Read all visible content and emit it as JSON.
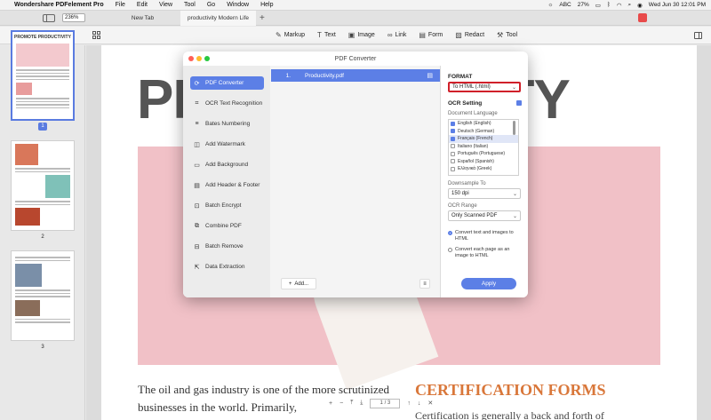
{
  "menubar": {
    "app_name": "Wondershare PDFelement Pro",
    "items": [
      "File",
      "Edit",
      "View",
      "Tool",
      "Go",
      "Window",
      "Help"
    ],
    "input_method": "ABC",
    "battery": "27%",
    "datetime": "Wed Jun 30  12:01 PM"
  },
  "tabs": {
    "zoom": "236%",
    "items": [
      {
        "label": "New Tab"
      },
      {
        "label": "productivity Modern Life"
      }
    ]
  },
  "toolbar": {
    "tools": [
      {
        "label": "Markup",
        "icon": "pen-icon",
        "glyph": "✎"
      },
      {
        "label": "Text",
        "icon": "text-icon",
        "glyph": "T"
      },
      {
        "label": "Image",
        "icon": "image-icon",
        "glyph": "▣"
      },
      {
        "label": "Link",
        "icon": "link-icon",
        "glyph": "∞"
      },
      {
        "label": "Form",
        "icon": "form-icon",
        "glyph": "▤"
      },
      {
        "label": "Redact",
        "icon": "redact-icon",
        "glyph": "▨"
      },
      {
        "label": "Tool",
        "icon": "toolbox-icon",
        "glyph": "⚒"
      }
    ]
  },
  "thumbnails": {
    "first_title": "PROMOTE PRODUCTIVITY",
    "pages": [
      "1",
      "2",
      "3"
    ]
  },
  "document": {
    "title_left": "PR",
    "title_right": "TIVITY",
    "body_text": "The oil and gas industry is one of the more scrutinized businesses in the world. Primarily,",
    "section_title": "CERTIFICATION FORMS",
    "section_text": "Certification is generally a back and forth of"
  },
  "pagenav": {
    "current": "1",
    "separator": "/",
    "total": "3"
  },
  "dialog": {
    "title": "PDF Converter",
    "nav": [
      {
        "label": "PDF Converter",
        "glyph": "⟳"
      },
      {
        "label": "OCR Text Recognition",
        "glyph": "⌗"
      },
      {
        "label": "Bates Numbering",
        "glyph": "≡"
      },
      {
        "label": "Add Watermark",
        "glyph": "◫"
      },
      {
        "label": "Add Background",
        "glyph": "▭"
      },
      {
        "label": "Add Header & Footer",
        "glyph": "▤"
      },
      {
        "label": "Batch Encrypt",
        "glyph": "⊡"
      },
      {
        "label": "Combine PDF",
        "glyph": "⧉"
      },
      {
        "label": "Batch Remove",
        "glyph": "⊟"
      },
      {
        "label": "Data Extraction",
        "glyph": "⇱"
      }
    ],
    "file": {
      "num": "1.",
      "name": "Productivity.pdf"
    },
    "add_label": "Add...",
    "format_label": "FORMAT",
    "format_value": "To HTML (.html)",
    "ocr_label": "OCR Setting",
    "doc_lang_label": "Document Language",
    "languages": [
      {
        "name": "English (English)",
        "checked": true
      },
      {
        "name": "Deutsch (German)",
        "checked": true
      },
      {
        "name": "Français (French)",
        "checked": true
      },
      {
        "name": "Italiano (Italian)",
        "checked": false
      },
      {
        "name": "Português (Portuguese)",
        "checked": false
      },
      {
        "name": "Español (Spanish)",
        "checked": false
      },
      {
        "name": "Ελληνικά (Greek)",
        "checked": false
      }
    ],
    "downsample_label": "Downsample To",
    "downsample_value": "150 dpi",
    "ocr_range_label": "OCR Range",
    "ocr_range_value": "Only Scanned PDF",
    "option1": "Convert text and images to HTML",
    "option2": "Convert each page as an image to HTML",
    "apply_label": "Apply"
  }
}
